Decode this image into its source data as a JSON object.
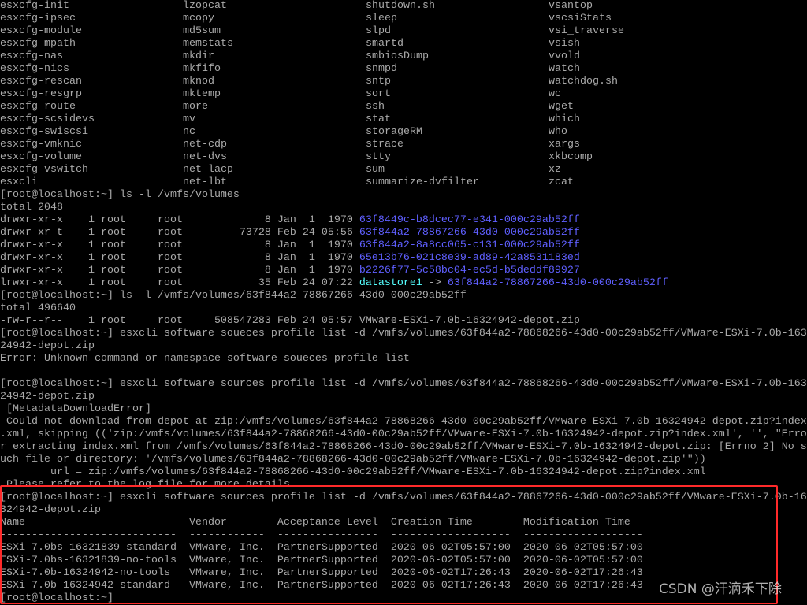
{
  "colors": {
    "text": "#aaaaaa",
    "dir": "#5f5fff",
    "link": "#55ffff",
    "highlight": "#ff2a2a",
    "background": "#000000"
  },
  "listing": {
    "columns": [
      [
        "esxcfg-init",
        "esxcfg-ipsec",
        "esxcfg-module",
        "esxcfg-mpath",
        "esxcfg-nas",
        "esxcfg-nics",
        "esxcfg-rescan",
        "esxcfg-resgrp",
        "esxcfg-route",
        "esxcfg-scsidevs",
        "esxcfg-swiscsi",
        "esxcfg-vmknic",
        "esxcfg-volume",
        "esxcfg-vswitch",
        "esxcli"
      ],
      [
        "lzopcat",
        "mcopy",
        "md5sum",
        "memstats",
        "mkdir",
        "mkfifo",
        "mknod",
        "mktemp",
        "more",
        "mv",
        "nc",
        "net-cdp",
        "net-dvs",
        "net-lacp",
        "net-lbt"
      ],
      [
        "shutdown.sh",
        "sleep",
        "slpd",
        "smartd",
        "smbiosDump",
        "snmpd",
        "sntp",
        "sort",
        "ssh",
        "stat",
        "storageRM",
        "strace",
        "stty",
        "sum",
        "summarize-dvfilter"
      ],
      [
        "vsantop",
        "vscsiStats",
        "vsi_traverse",
        "vsish",
        "vvold",
        "watch",
        "watchdog.sh",
        "wc",
        "wget",
        "which",
        "who",
        "xargs",
        "xkbcomp",
        "xz",
        "zcat"
      ]
    ]
  },
  "lines": [
    [
      {
        "t": "[root@localhost:~] ls -l /vmfs/volumes"
      }
    ],
    [
      {
        "t": "total 2048"
      }
    ],
    [
      {
        "t": "drwxr-xr-x    1 root     root             8 Jan  1  1970 "
      },
      {
        "t": "63f8449c-b8dcec77-e341-000c29ab52ff",
        "c": "dir"
      }
    ],
    [
      {
        "t": "drwxr-xr-t    1 root     root         73728 Feb 24 05:56 "
      },
      {
        "t": "63f844a2-78867266-43d0-000c29ab52ff",
        "c": "dir"
      }
    ],
    [
      {
        "t": "drwxr-xr-x    1 root     root             8 Jan  1  1970 "
      },
      {
        "t": "63f844a2-8a8cc065-c131-000c29ab52ff",
        "c": "dir"
      }
    ],
    [
      {
        "t": "drwxr-xr-x    1 root     root             8 Jan  1  1970 "
      },
      {
        "t": "65e13b76-021c8e39-ad89-42a8531183ed",
        "c": "dir"
      }
    ],
    [
      {
        "t": "drwxr-xr-x    1 root     root             8 Jan  1  1970 "
      },
      {
        "t": "b2226f77-5c58bc04-ec5d-b5deddf89927",
        "c": "dir"
      }
    ],
    [
      {
        "t": "lrwxr-xr-x    1 root     root            35 Feb 24 07:22 "
      },
      {
        "t": "datastore1",
        "c": "link"
      },
      {
        "t": " -> "
      },
      {
        "t": "63f844a2-78867266-43d0-000c29ab52ff",
        "c": "dir"
      }
    ],
    [
      {
        "t": "[root@localhost:~] ls -l /vmfs/volumes/63f844a2-78867266-43d0-000c29ab52ff"
      }
    ],
    [
      {
        "t": "total 496640"
      }
    ],
    [
      {
        "t": "-rw-r--r--    1 root     root     508547283 Feb 24 05:57 VMware-ESXi-7.0b-16324942-depot.zip"
      }
    ],
    [
      {
        "t": "[root@localhost:~] esxcli software soueces profile list -d /vmfs/volumes/63f844a2-78868266-43d0-00c29ab52ff/VMware-ESXi-7.0b-163"
      }
    ],
    [
      {
        "t": "24942-depot.zip"
      }
    ],
    [
      {
        "t": "Error: Unknown command or namespace software soueces profile list"
      }
    ],
    [
      {
        "t": ""
      }
    ],
    [
      {
        "t": "[root@localhost:~] esxcli software sources profile list -d /vmfs/volumes/63f844a2-78868266-43d0-00c29ab52ff/VMware-ESXi-7.0b-163"
      }
    ],
    [
      {
        "t": "24942-depot.zip"
      }
    ],
    [
      {
        "t": " [MetadataDownloadError]"
      }
    ],
    [
      {
        "t": " Could not download from depot at zip:/vmfs/volumes/63f844a2-78868266-43d0-00c29ab52ff/VMware-ESXi-7.0b-16324942-depot.zip?index"
      }
    ],
    [
      {
        "t": ".xml, skipping (('zip:/vmfs/volumes/63f844a2-78868266-43d0-00c29ab52ff/VMware-ESXi-7.0b-16324942-depot.zip?index.xml', '', \"Erro"
      }
    ],
    [
      {
        "t": "r extracting index.xml from /vmfs/volumes/63f844a2-78868266-43d0-00c29ab52ff/VMware-ESXi-7.0b-16324942-depot.zip: [Errno 2] No s"
      }
    ],
    [
      {
        "t": "uch file or directory: '/vmfs/volumes/63f844a2-78868266-43d0-00c29ab52ff/VMware-ESXi-7.0b-16324942-depot.zip'\"))"
      }
    ],
    [
      {
        "t": "        url = zip:/vmfs/volumes/63f844a2-78868266-43d0-00c29ab52ff/VMware-ESXi-7.0b-16324942-depot.zip?index.xml"
      }
    ],
    [
      {
        "t": " Please refer to the log file for more details."
      }
    ],
    [
      {
        "t": "[root@localhost:~] esxcli software sources profile list -d /vmfs/volumes/63f844a2-78867266-43d0-000c29ab52ff/VMware-ESXi-7.0b-16"
      }
    ],
    [
      {
        "t": "324942-depot.zip"
      }
    ],
    [
      {
        "t": "Name                          Vendor        Acceptance Level  Creation Time        Modification Time"
      }
    ],
    [
      {
        "t": "----------------------------  ------------  ----------------  -------------------  -------------------"
      }
    ],
    [
      {
        "t": "ESXi-7.0bs-16321839-standard  VMware, Inc.  PartnerSupported  2020-06-02T05:57:00  2020-06-02T05:57:00"
      }
    ],
    [
      {
        "t": "ESXi-7.0bs-16321839-no-tools  VMware, Inc.  PartnerSupported  2020-06-02T05:57:00  2020-06-02T05:57:00"
      }
    ],
    [
      {
        "t": "ESXi-7.0b-16324942-no-tools   VMware, Inc.  PartnerSupported  2020-06-02T17:26:43  2020-06-02T17:26:43"
      }
    ],
    [
      {
        "t": "ESXi-7.0b-16324942-standard   VMware, Inc.  PartnerSupported  2020-06-02T17:26:43  2020-06-02T17:26:43"
      }
    ],
    [
      {
        "t": "[root@localhost:~]"
      }
    ]
  ],
  "watermark": "CSDN @汗滴禾下除"
}
